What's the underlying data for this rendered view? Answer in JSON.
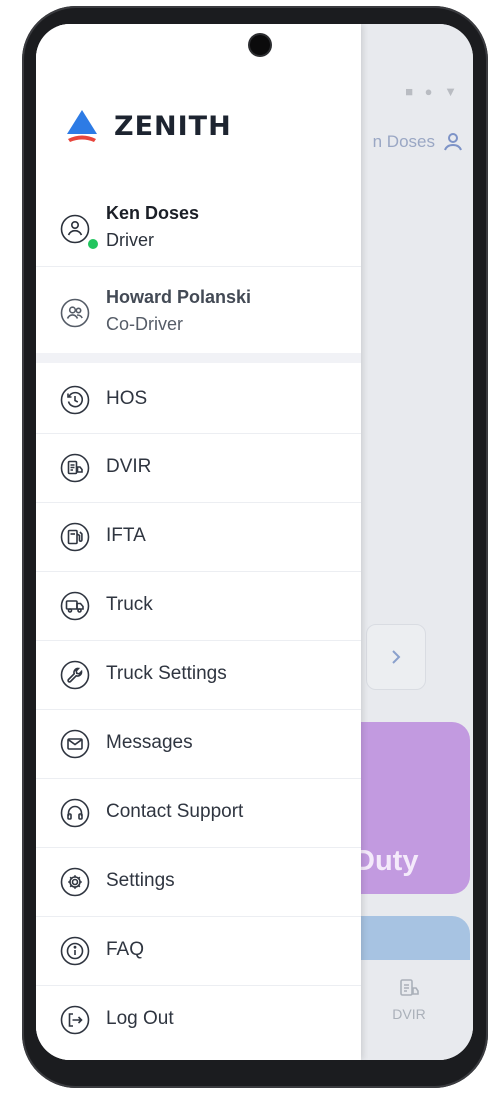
{
  "background": {
    "status_icons": "■ ● ▼",
    "current_user_partial": "n Doses",
    "card_purple_text": "Duty",
    "bottom_tab_label": "DVIR",
    "accent_green": "#9fd4a9",
    "accent_purple": "#c29ae0",
    "accent_blue": "#a7c3e2"
  },
  "drawer": {
    "brand": "ZENITH",
    "users": [
      {
        "name": "Ken Doses",
        "role": "Driver",
        "status": "online"
      },
      {
        "name": "Howard Polanski",
        "role": "Co-Driver"
      }
    ],
    "menu": [
      {
        "label": "HOS",
        "icon": "clock-history-icon"
      },
      {
        "label": "DVIR",
        "icon": "clipboard-truck-icon"
      },
      {
        "label": "IFTA",
        "icon": "fuel-pump-icon"
      },
      {
        "label": "Truck",
        "icon": "truck-icon"
      },
      {
        "label": "Truck Settings",
        "icon": "wrench-icon"
      },
      {
        "label": "Messages",
        "icon": "envelope-icon"
      },
      {
        "label": "Contact Support",
        "icon": "headphones-icon"
      },
      {
        "label": "Settings",
        "icon": "gear-icon"
      },
      {
        "label": "FAQ",
        "icon": "info-icon"
      },
      {
        "label": "Log Out",
        "icon": "logout-icon"
      }
    ]
  }
}
